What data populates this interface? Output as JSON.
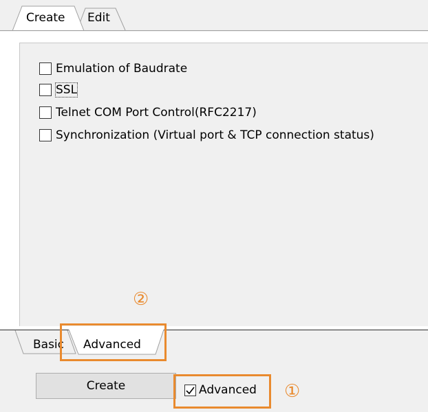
{
  "top_tabs": [
    "Create",
    "Edit"
  ],
  "options": [
    {
      "label": "Emulation of Baudrate",
      "checked": false
    },
    {
      "label": "SSL",
      "checked": false
    },
    {
      "label": "Telnet COM Port Control(RFC2217)",
      "checked": false
    },
    {
      "label": "Synchronization (Virtual port & TCP connection status)",
      "checked": false
    }
  ],
  "bottom_tabs": [
    "Basic",
    "Advanced"
  ],
  "create_button": "Create",
  "advanced_checkbox": {
    "label": "Advanced",
    "checked": true
  },
  "callouts": {
    "one": "①",
    "two": "②"
  },
  "colors": {
    "highlight": "#e98a2e"
  }
}
